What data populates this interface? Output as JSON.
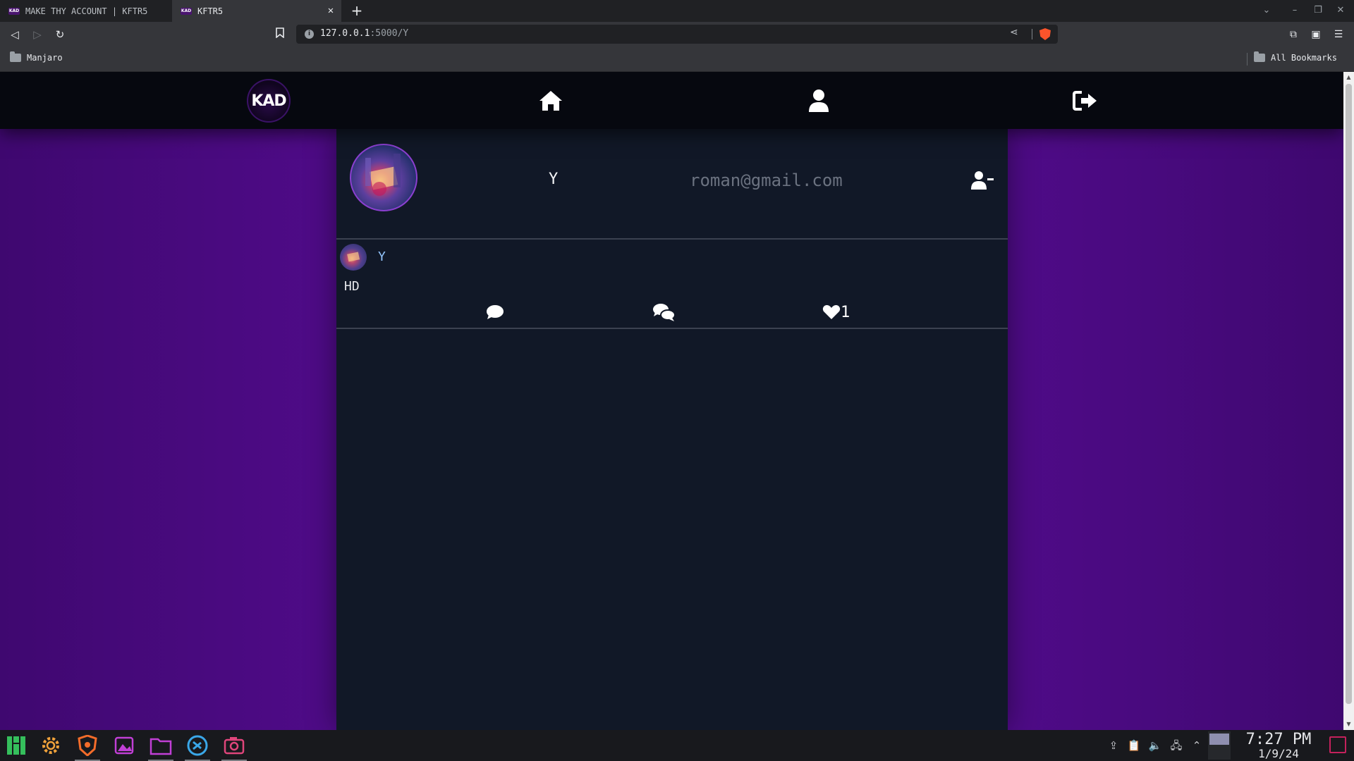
{
  "browser": {
    "tabs": [
      {
        "title": "MAKE THY ACCOUNT | KFTR5",
        "favicon": "KAD"
      },
      {
        "title": "KFTR5",
        "favicon": "KAD"
      }
    ],
    "address": {
      "host": "127.0.0.1",
      "rest": ":5000/Y"
    },
    "bookmarks": {
      "left": "Manjaro",
      "right": "All Bookmarks"
    }
  },
  "site": {
    "logo_text": "KAD",
    "nav": [
      "home-icon",
      "user-icon",
      "logout-icon"
    ]
  },
  "profile": {
    "username": "Y",
    "email": "roman@gmail.com"
  },
  "posts": [
    {
      "author": "Y",
      "text": "HD",
      "like_count": "1"
    }
  ],
  "taskbar": {
    "time": "7:27 PM",
    "date": "1/9/24"
  },
  "colors": {
    "page_background": "#4a0a7e",
    "card_background": "#111827",
    "nav_background": "#06080f",
    "author_link": "#93c5fd",
    "email_text": "#6b7280"
  }
}
